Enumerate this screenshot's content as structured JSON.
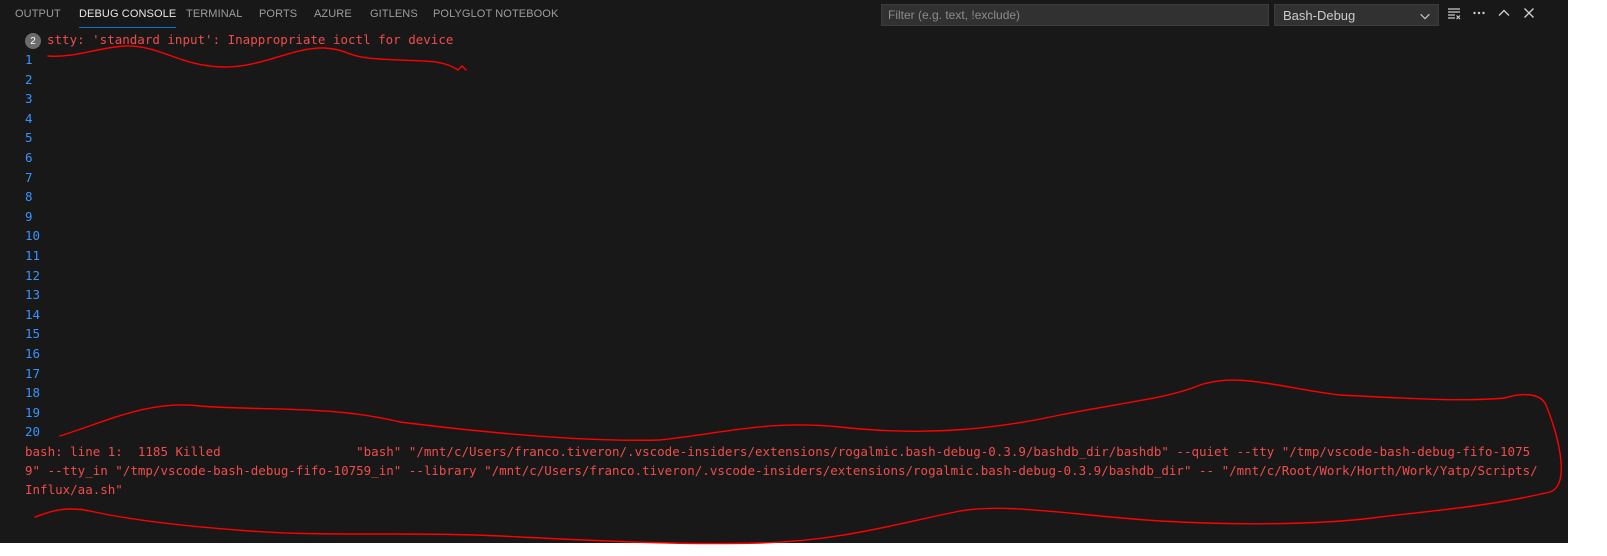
{
  "tabs": [
    {
      "label": "OUTPUT"
    },
    {
      "label": "DEBUG CONSOLE",
      "active": true
    },
    {
      "label": "TERMINAL"
    },
    {
      "label": "PORTS"
    },
    {
      "label": "AZURE"
    },
    {
      "label": "GITLENS"
    },
    {
      "label": "POLYGLOT NOTEBOOK"
    }
  ],
  "filter": {
    "placeholder": "Filter (e.g. text, !exclude)",
    "value": ""
  },
  "session_select": {
    "value": "Bash-Debug"
  },
  "actions": [
    {
      "icon": "clear-console-icon"
    },
    {
      "icon": "more-actions-icon"
    },
    {
      "icon": "maximize-panel-icon"
    },
    {
      "icon": "close-panel-icon"
    }
  ],
  "console": {
    "repeat_count": "2",
    "first_error": "stty: 'standard input': Inappropriate ioctl for device",
    "numbers": [
      "1",
      "2",
      "3",
      "4",
      "5",
      "6",
      "7",
      "8",
      "9",
      "10",
      "11",
      "12",
      "13",
      "14",
      "15",
      "16",
      "17",
      "18",
      "19",
      "20"
    ],
    "killed_lines": [
      "bash: line 1:  1185 Killed                  \"bash\" \"/mnt/c/Users/franco.tiveron/.vscode-insiders/extensions/rogalmic.bash-debug-0.3.9/bashdb_dir/bashdb\" --quiet --tty \"/tmp/vscode-bash-debug-fifo-1075",
      "9\" --tty_in \"/tmp/vscode-bash-debug-fifo-10759_in\" --library \"/mnt/c/Users/franco.tiveron/.vscode-insiders/extensions/rogalmic.bash-debug-0.3.9/bashdb_dir\" -- \"/mnt/c/Root/Work/Horth/Work/Yatp/Scripts/",
      "Influx/aa.sh\""
    ]
  },
  "colors": {
    "panel_bg": "#181818",
    "error_text": "#f14c4c",
    "number_text": "#3794ff",
    "active_tab_underline": "#0078d4",
    "annotation_ink": "#ff0000"
  }
}
